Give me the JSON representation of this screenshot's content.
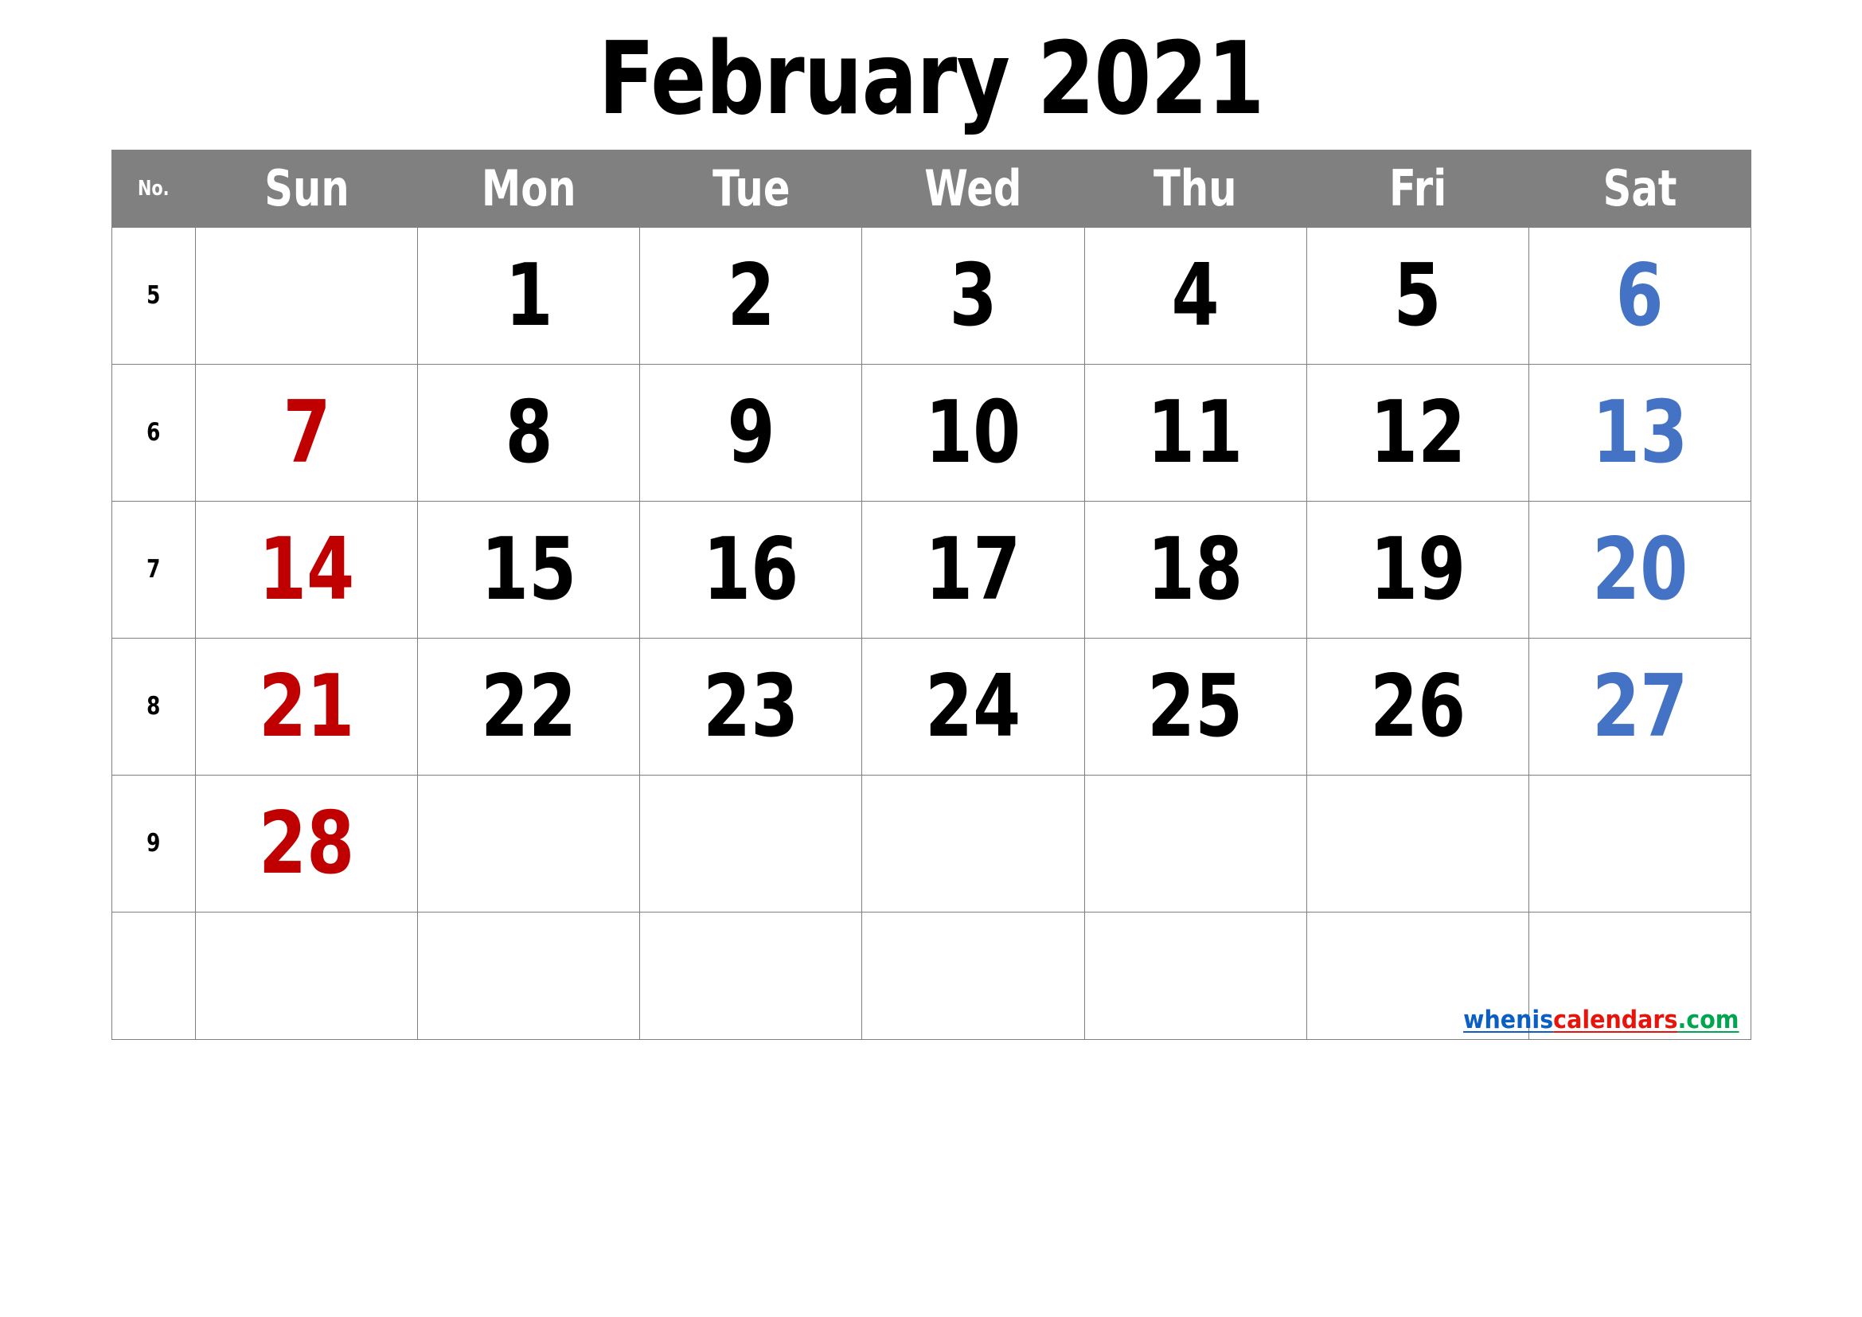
{
  "title": "February 2021",
  "month": "February",
  "year": "2021",
  "header": {
    "week_no_label": "No.",
    "days": [
      "Sun",
      "Mon",
      "Tue",
      "Wed",
      "Thu",
      "Fri",
      "Sat"
    ]
  },
  "colors": {
    "header_background": "#808080",
    "header_text": "#FFFFFF",
    "grid_line": "#7F7F7F",
    "weekday": "#000000",
    "sunday": "#C00000",
    "saturday": "#4472C4",
    "link_blue": "#0B5FC4",
    "link_red": "#E8140B",
    "link_green": "#00A550"
  },
  "weeks": [
    {
      "no": "5",
      "days": [
        "",
        "1",
        "2",
        "3",
        "4",
        "5",
        "6"
      ]
    },
    {
      "no": "6",
      "days": [
        "7",
        "8",
        "9",
        "10",
        "11",
        "12",
        "13"
      ]
    },
    {
      "no": "7",
      "days": [
        "14",
        "15",
        "16",
        "17",
        "18",
        "19",
        "20"
      ]
    },
    {
      "no": "8",
      "days": [
        "21",
        "22",
        "23",
        "24",
        "25",
        "26",
        "27"
      ]
    },
    {
      "no": "9",
      "days": [
        "28",
        "",
        "",
        "",
        "",
        "",
        ""
      ]
    },
    {
      "no": "",
      "days": [
        "",
        "",
        "",
        "",
        "",
        "",
        ""
      ]
    }
  ],
  "footer": {
    "link_part_1": "whenis",
    "link_part_2": "calendars",
    "link_part_3": ".com"
  }
}
